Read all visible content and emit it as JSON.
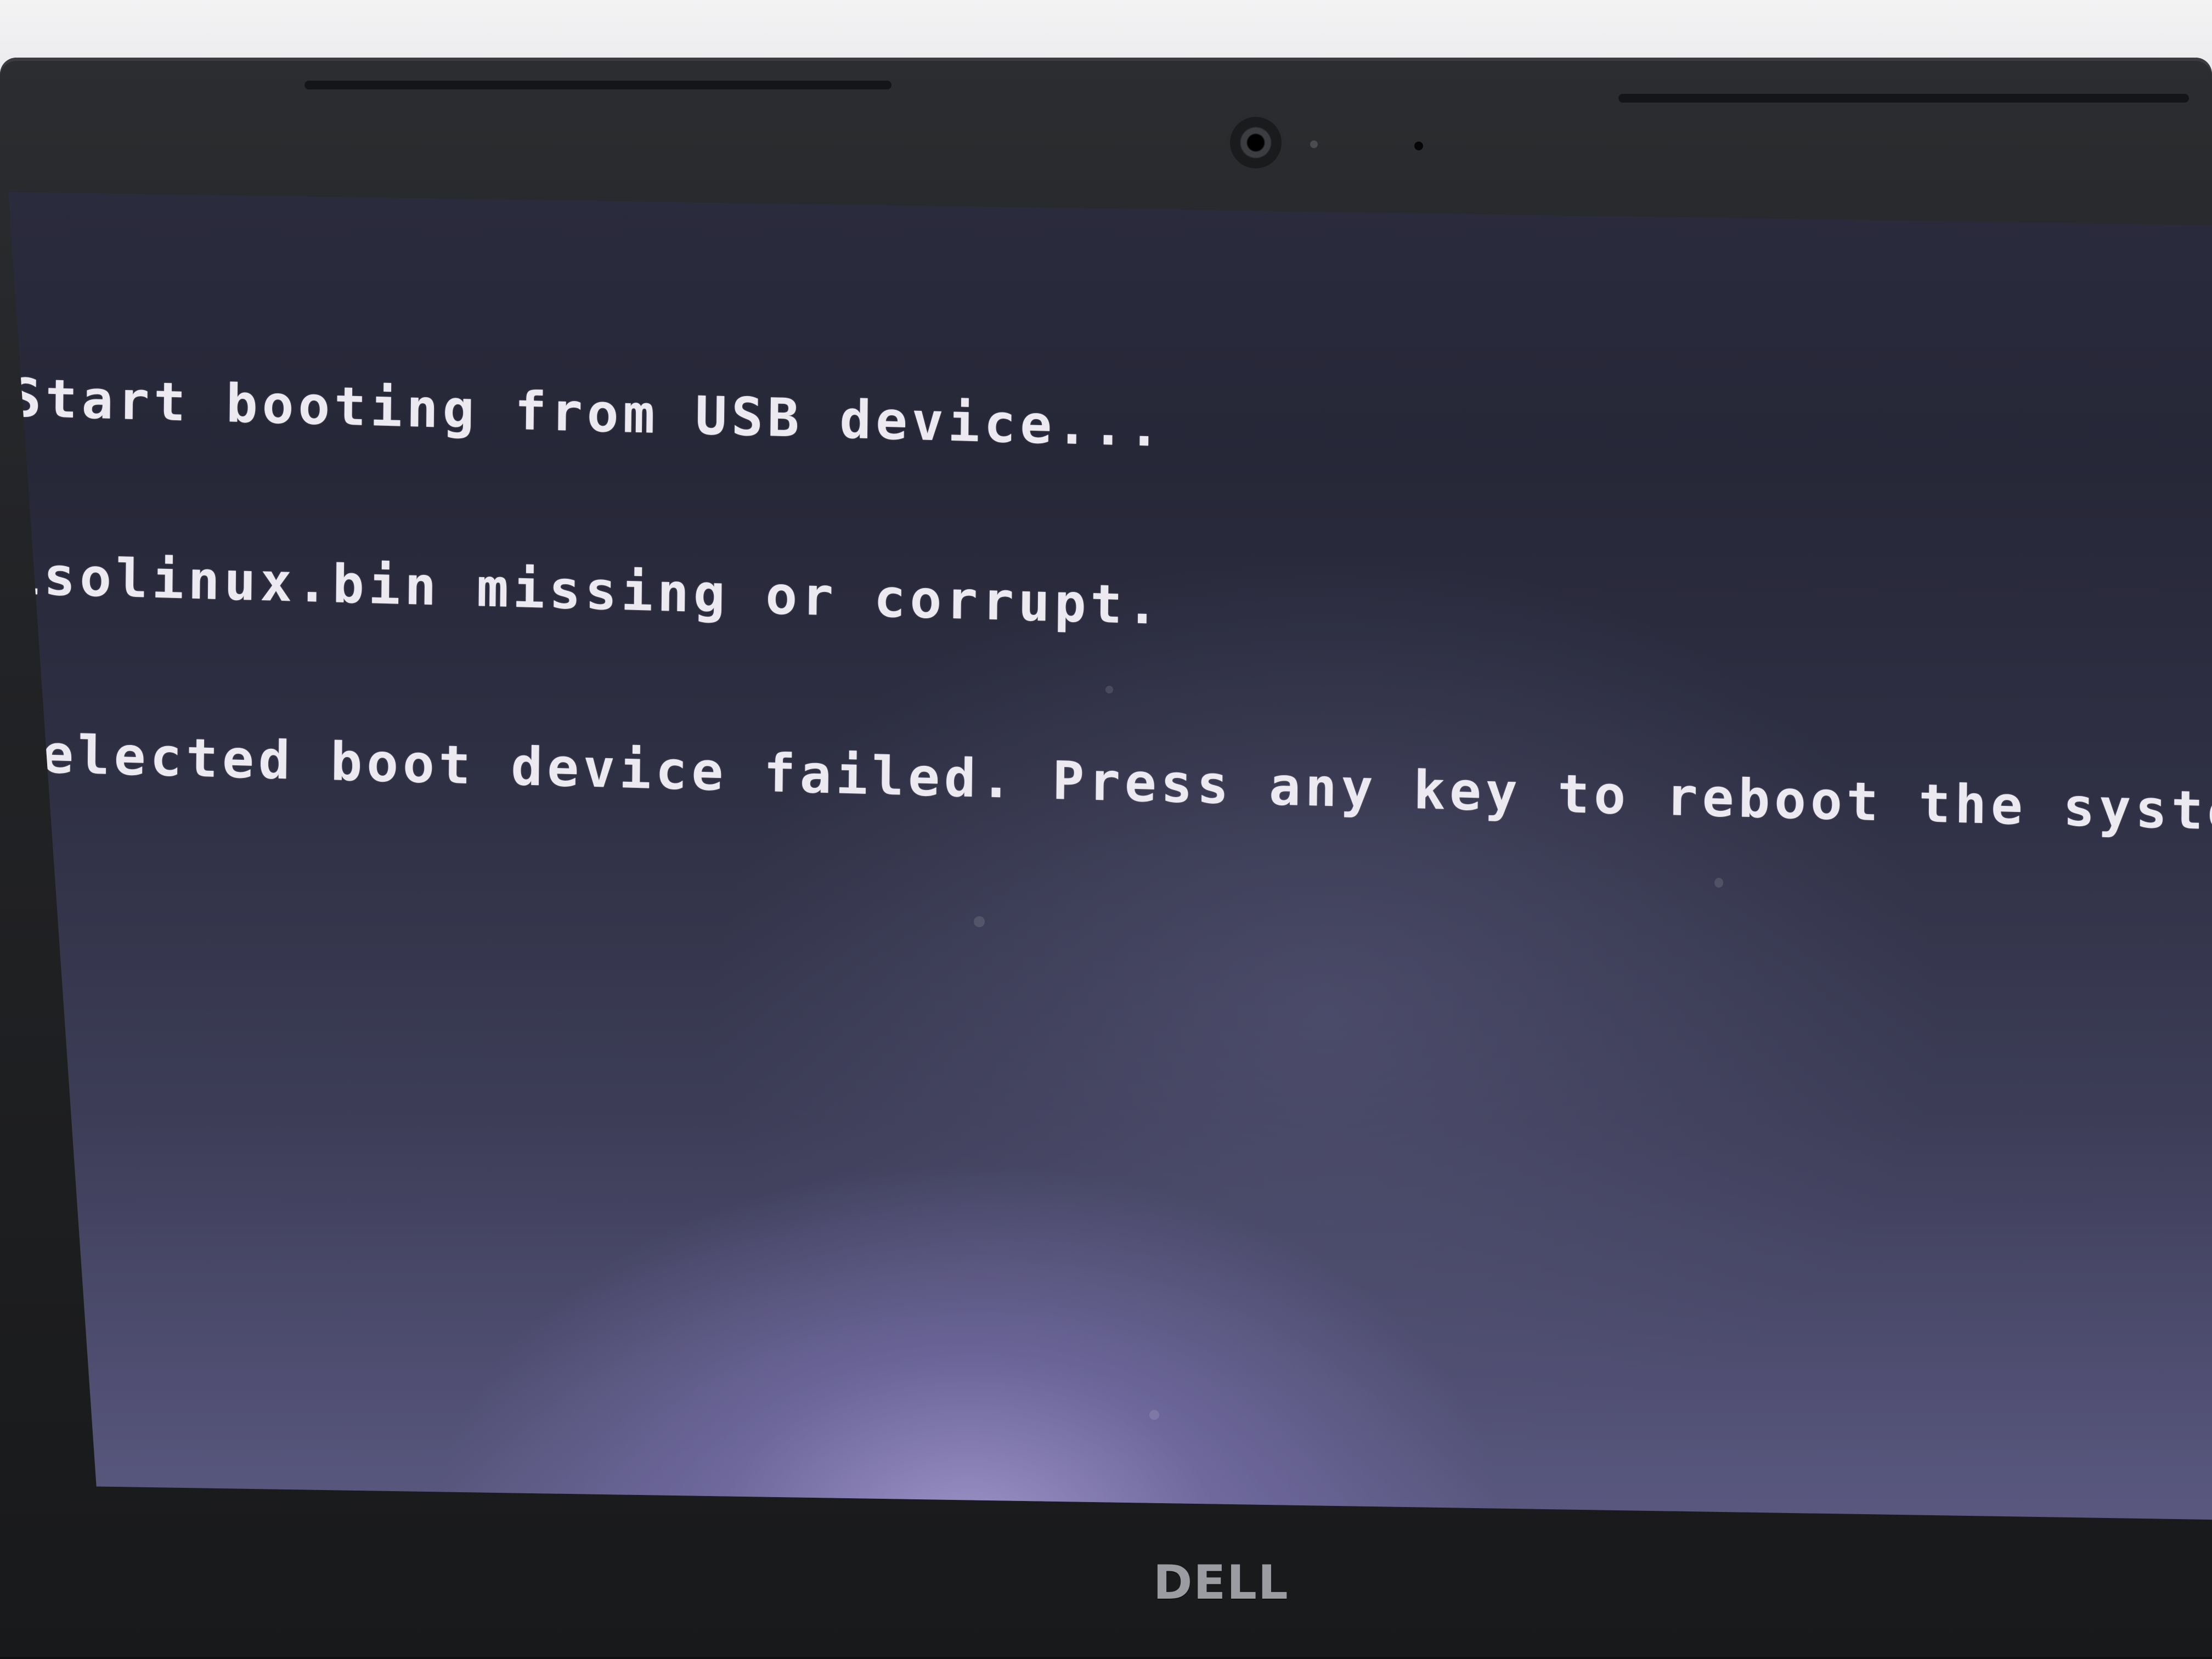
{
  "terminal": {
    "lines": [
      "Start booting from USB device...",
      "isolinux.bin missing or corrupt.",
      "Selected boot device failed. Press any key to reboot the system."
    ],
    "colors": {
      "text": "#eceaf0",
      "background": "#2a2b3d"
    }
  },
  "device": {
    "logo": "DELL",
    "camera_icon": "webcam-icon"
  }
}
